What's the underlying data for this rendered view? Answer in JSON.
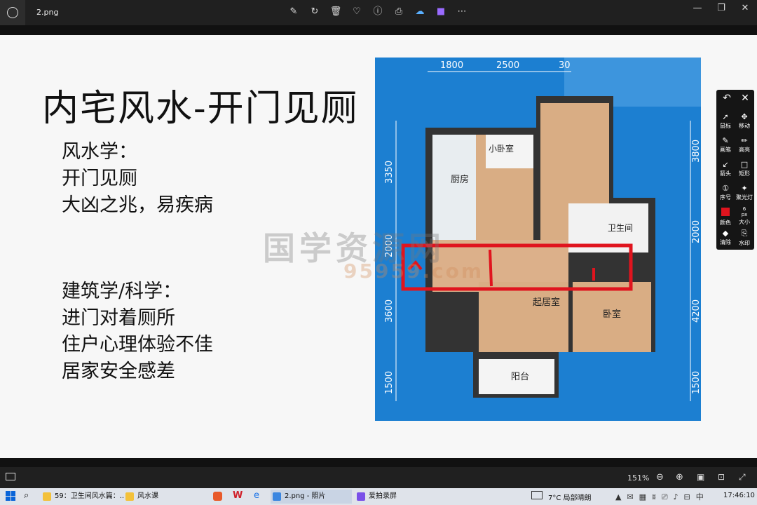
{
  "window": {
    "filename": "2.png"
  },
  "toolbar_icons": [
    "edit-icon",
    "rotate-icon",
    "delete-icon",
    "favorite-icon",
    "info-icon",
    "print-icon",
    "cloud-icon",
    "clipchamp-icon",
    "more-icon"
  ],
  "slide": {
    "title": "内宅风水-开门见厕",
    "left_block1": [
      "风水学：",
      "开门见厕",
      "大凶之兆，易疾病"
    ],
    "left_block2": [
      "建筑学/科学：",
      "进门对着厕所",
      "住户心理体验不佳",
      "居家安全感差"
    ],
    "watermark": "国学资源网",
    "watermark_url": "95959.com"
  },
  "plan": {
    "dims_top": [
      "1800",
      "2500",
      "30"
    ],
    "dims_left": [
      "3350",
      "2000",
      "3600",
      "1500"
    ],
    "dims_right": [
      "3800",
      "2000",
      "4200",
      "1500"
    ],
    "rooms": {
      "small_bedroom": "小卧室",
      "kitchen": "厨房",
      "toilet": "卫生间",
      "living": "起居室",
      "bedroom": "卧室",
      "balcony": "阳台"
    },
    "highlight_color": "#e0141e"
  },
  "annot_tools": [
    {
      "label": "鼠标",
      "icon": "cursor-icon"
    },
    {
      "label": "移动",
      "icon": "move-icon"
    },
    {
      "label": "画笔",
      "icon": "pen-icon"
    },
    {
      "label": "高亮",
      "icon": "highlighter-icon"
    },
    {
      "label": "箭头",
      "icon": "arrow-icon"
    },
    {
      "label": "矩形",
      "icon": "rectangle-icon"
    },
    {
      "label": "序号",
      "icon": "number-icon"
    },
    {
      "label": "聚光灯",
      "icon": "spotlight-icon"
    },
    {
      "label": "颜色",
      "icon": "color-icon"
    },
    {
      "label": "大小",
      "icon": "size-icon"
    },
    {
      "label": "清除",
      "icon": "eraser-icon"
    },
    {
      "label": "水印",
      "icon": "watermark-icon"
    }
  ],
  "size_value": "6\npx",
  "zoom": "151%",
  "taskbar": {
    "items": [
      "59：卫生间风水篇：...",
      "风水课",
      "",
      "",
      "",
      "2.png - 照片",
      "爱拍录屏"
    ],
    "weather": "7°C  局部晴朗",
    "time": "17:46:10"
  }
}
